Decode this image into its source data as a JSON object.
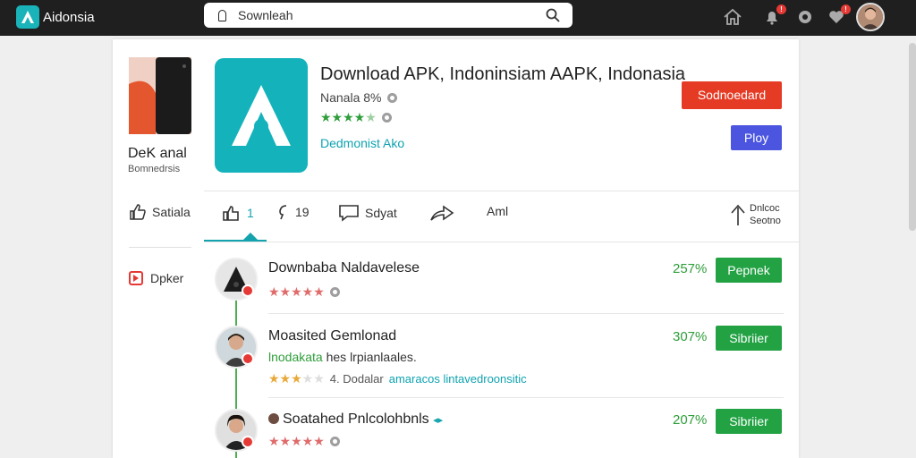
{
  "topbar": {
    "brand_name": "Aidonsia",
    "search_value": "Sownleah",
    "icons": [
      "home-icon",
      "notification-icon",
      "settings-icon",
      "alert-icon",
      "avatar"
    ]
  },
  "sidebar": {
    "name": "DeK anal",
    "sub": "Bomnedrsis",
    "like_label": "Satiala",
    "link_label": "Dpker"
  },
  "app": {
    "title": "Download APK, Indoninsiam AAPK, Indonasia",
    "developer": "Nanala 8%",
    "link": "Dedmonist Ako",
    "download_label": "Sodnoedard",
    "play_label": "Ploy",
    "rating_stars": 4
  },
  "actions": [
    {
      "icon": "like-icon",
      "label": "1"
    },
    {
      "icon": "comment-icon",
      "label": "19"
    },
    {
      "icon": "chat-icon",
      "label": "Sdyat"
    },
    {
      "icon": "share-icon",
      "label": ""
    },
    {
      "icon": "",
      "label": "Aml"
    }
  ],
  "action_right": {
    "line1": "Dnlcoc",
    "line2": "Seotno"
  },
  "list": [
    {
      "title": "Downbaba Naldavelese",
      "percent": "257%",
      "button": "Pepnek",
      "stars": 5
    },
    {
      "title": "Moasited Gemlonad",
      "sub_green": "lnodakata",
      "sub_rest": " hes lrpianlaales.",
      "meta_prefix": "4. Dodalar",
      "meta_teal": "amaracos lintavedroonsitic",
      "percent": "307%",
      "button": "Sibriier",
      "stars": 3
    },
    {
      "title": "Soatahed Pnlcolohbnls",
      "percent": "207%",
      "button": "Sibriier",
      "stars": 5
    }
  ],
  "colors": {
    "accent_teal": "#14b3bb",
    "download_red": "#e53a24",
    "play_blue": "#4b55e0",
    "action_green": "#23a244"
  }
}
